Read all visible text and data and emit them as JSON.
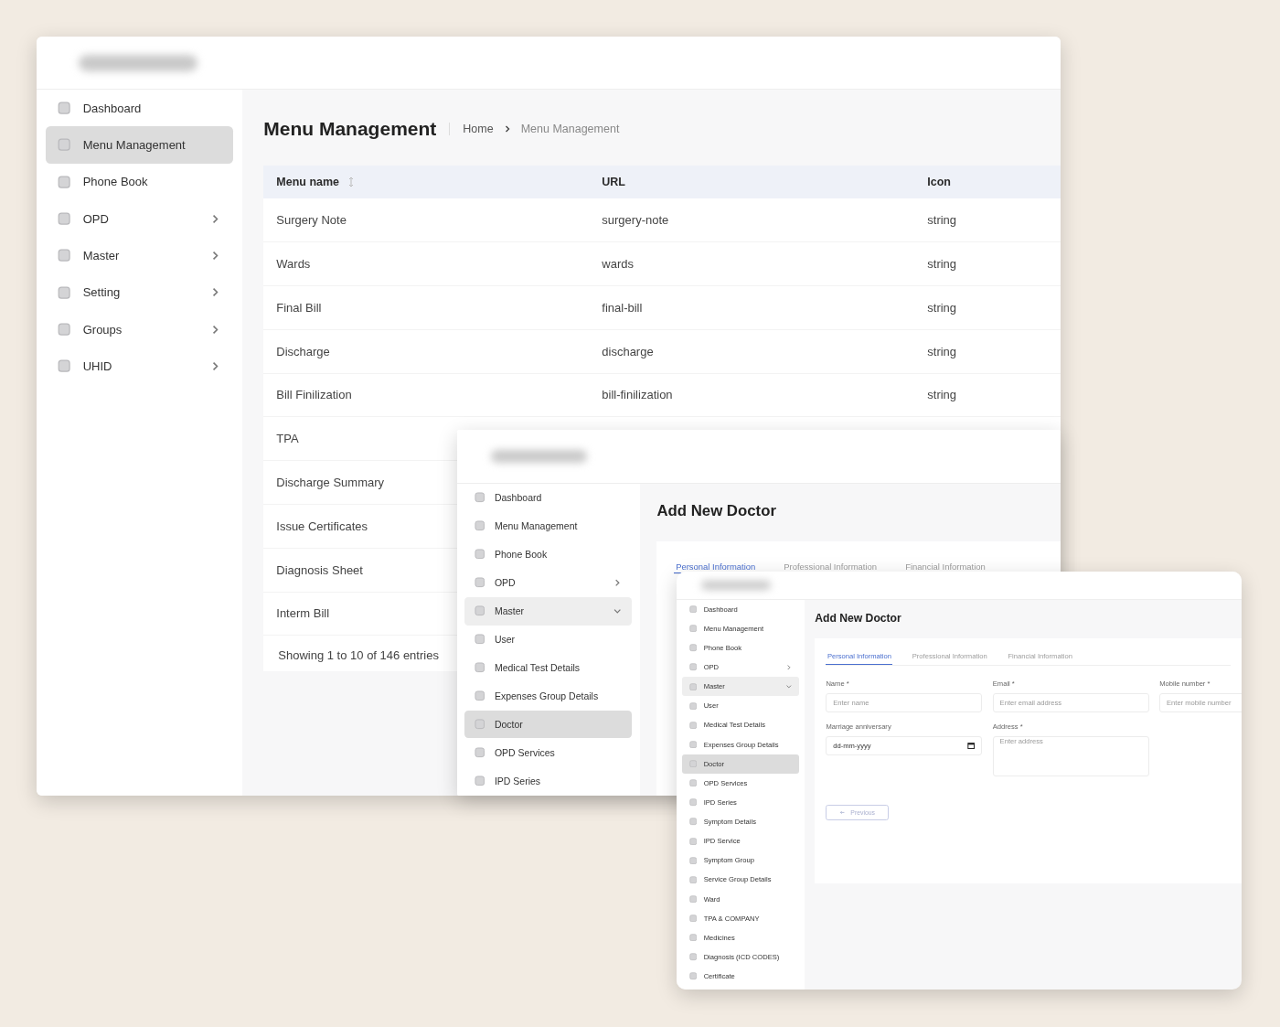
{
  "menu_management_window": {
    "sidebar": {
      "items": [
        {
          "label": "Dashboard",
          "selected": false
        },
        {
          "label": "Menu Management",
          "selected": true
        },
        {
          "label": "Phone Book",
          "selected": false
        },
        {
          "label": "OPD",
          "selected": false,
          "expanded": false
        },
        {
          "label": "Master",
          "selected": false,
          "expanded": false
        },
        {
          "label": "Setting",
          "selected": false,
          "expanded": false
        },
        {
          "label": "Groups",
          "selected": false,
          "expanded": false
        },
        {
          "label": "UHID",
          "selected": false,
          "expanded": false
        }
      ]
    },
    "title": "Menu Management",
    "breadcrumb": [
      "Home",
      "Menu Management"
    ],
    "table": {
      "columns": [
        "Menu name",
        "URL",
        "Icon"
      ],
      "rows": [
        {
          "menu_name": "Surgery Note",
          "url": "surgery-note",
          "icon": "string"
        },
        {
          "menu_name": "Wards",
          "url": "wards",
          "icon": "string"
        },
        {
          "menu_name": "Final Bill",
          "url": "final-bill",
          "icon": "string"
        },
        {
          "menu_name": "Discharge",
          "url": "discharge",
          "icon": "string"
        },
        {
          "menu_name": "Bill Finilization",
          "url": "bill-finilization",
          "icon": "string"
        },
        {
          "menu_name": "TPA"
        },
        {
          "menu_name": "Discharge Summary"
        },
        {
          "menu_name": "Issue Certificates"
        },
        {
          "menu_name": "Diagnosis Sheet"
        },
        {
          "menu_name": "Interm Bill"
        }
      ]
    },
    "footer": {
      "summary": "Showing 1 to 10 of 146 entries"
    }
  },
  "doctor_form_window": {
    "sidebar": {
      "items": [
        {
          "label": "Dashboard",
          "selected": false
        },
        {
          "label": "Menu Management",
          "selected": false
        },
        {
          "label": "Phone Book",
          "selected": false
        },
        {
          "label": "OPD",
          "selected": false,
          "expanded": false
        },
        {
          "label": "Master",
          "selected": false,
          "expanded": true
        },
        {
          "label": "User",
          "selected": false
        },
        {
          "label": "Medical Test Details",
          "selected": false
        },
        {
          "label": "Expenses Group Details",
          "selected": false
        },
        {
          "label": "Doctor",
          "selected": true
        },
        {
          "label": "OPD Services",
          "selected": false
        },
        {
          "label": "IPD Series",
          "selected": false
        }
      ]
    },
    "title": "Add New Doctor",
    "tabs": [
      {
        "label": "Personal Information",
        "selected": true
      },
      {
        "label": "Professional Information",
        "selected": false
      },
      {
        "label": "Financial Information",
        "selected": false
      }
    ]
  },
  "doctor_form_window_small": {
    "sidebar": {
      "items": [
        {
          "label": "Dashboard",
          "selected": false
        },
        {
          "label": "Menu Management",
          "selected": false
        },
        {
          "label": "Phone Book",
          "selected": false
        },
        {
          "label": "OPD",
          "selected": false,
          "expanded": false
        },
        {
          "label": "Master",
          "selected": false,
          "expanded": true
        },
        {
          "label": "User",
          "selected": false
        },
        {
          "label": "Medical Test Details",
          "selected": false
        },
        {
          "label": "Expenses Group Details",
          "selected": false
        },
        {
          "label": "Doctor",
          "selected": true
        },
        {
          "label": "OPD Services",
          "selected": false
        },
        {
          "label": "IPD Series",
          "selected": false
        },
        {
          "label": "Symptom Details",
          "selected": false
        },
        {
          "label": "IPD Service",
          "selected": false
        },
        {
          "label": "Symptom Group",
          "selected": false
        },
        {
          "label": "Service Group Details",
          "selected": false
        },
        {
          "label": "Ward",
          "selected": false
        },
        {
          "label": "TPA & COMPANY",
          "selected": false
        },
        {
          "label": "Medicines",
          "selected": false
        },
        {
          "label": "Diagnosis (ICD CODES)",
          "selected": false
        },
        {
          "label": "Certificate",
          "selected": false
        }
      ]
    },
    "title": "Add New Doctor",
    "tabs": [
      {
        "label": "Personal Information",
        "selected": true
      },
      {
        "label": "Professional Information",
        "selected": false
      },
      {
        "label": "Financial Information",
        "selected": false
      }
    ],
    "fields": [
      {
        "kind": "text",
        "label": "Name *",
        "placeholder": "Enter name"
      },
      {
        "kind": "text",
        "label": "Email *",
        "placeholder": "Enter email address"
      },
      {
        "kind": "text",
        "label": "Mobile number *",
        "placeholder": "Enter mobile number"
      },
      {
        "kind": "date",
        "label": "Marriage anniversary",
        "value": "dd-mm-yyyy"
      },
      {
        "kind": "textarea",
        "label": "Address *",
        "placeholder": "Enter address"
      }
    ],
    "previous_button": "Previous"
  }
}
